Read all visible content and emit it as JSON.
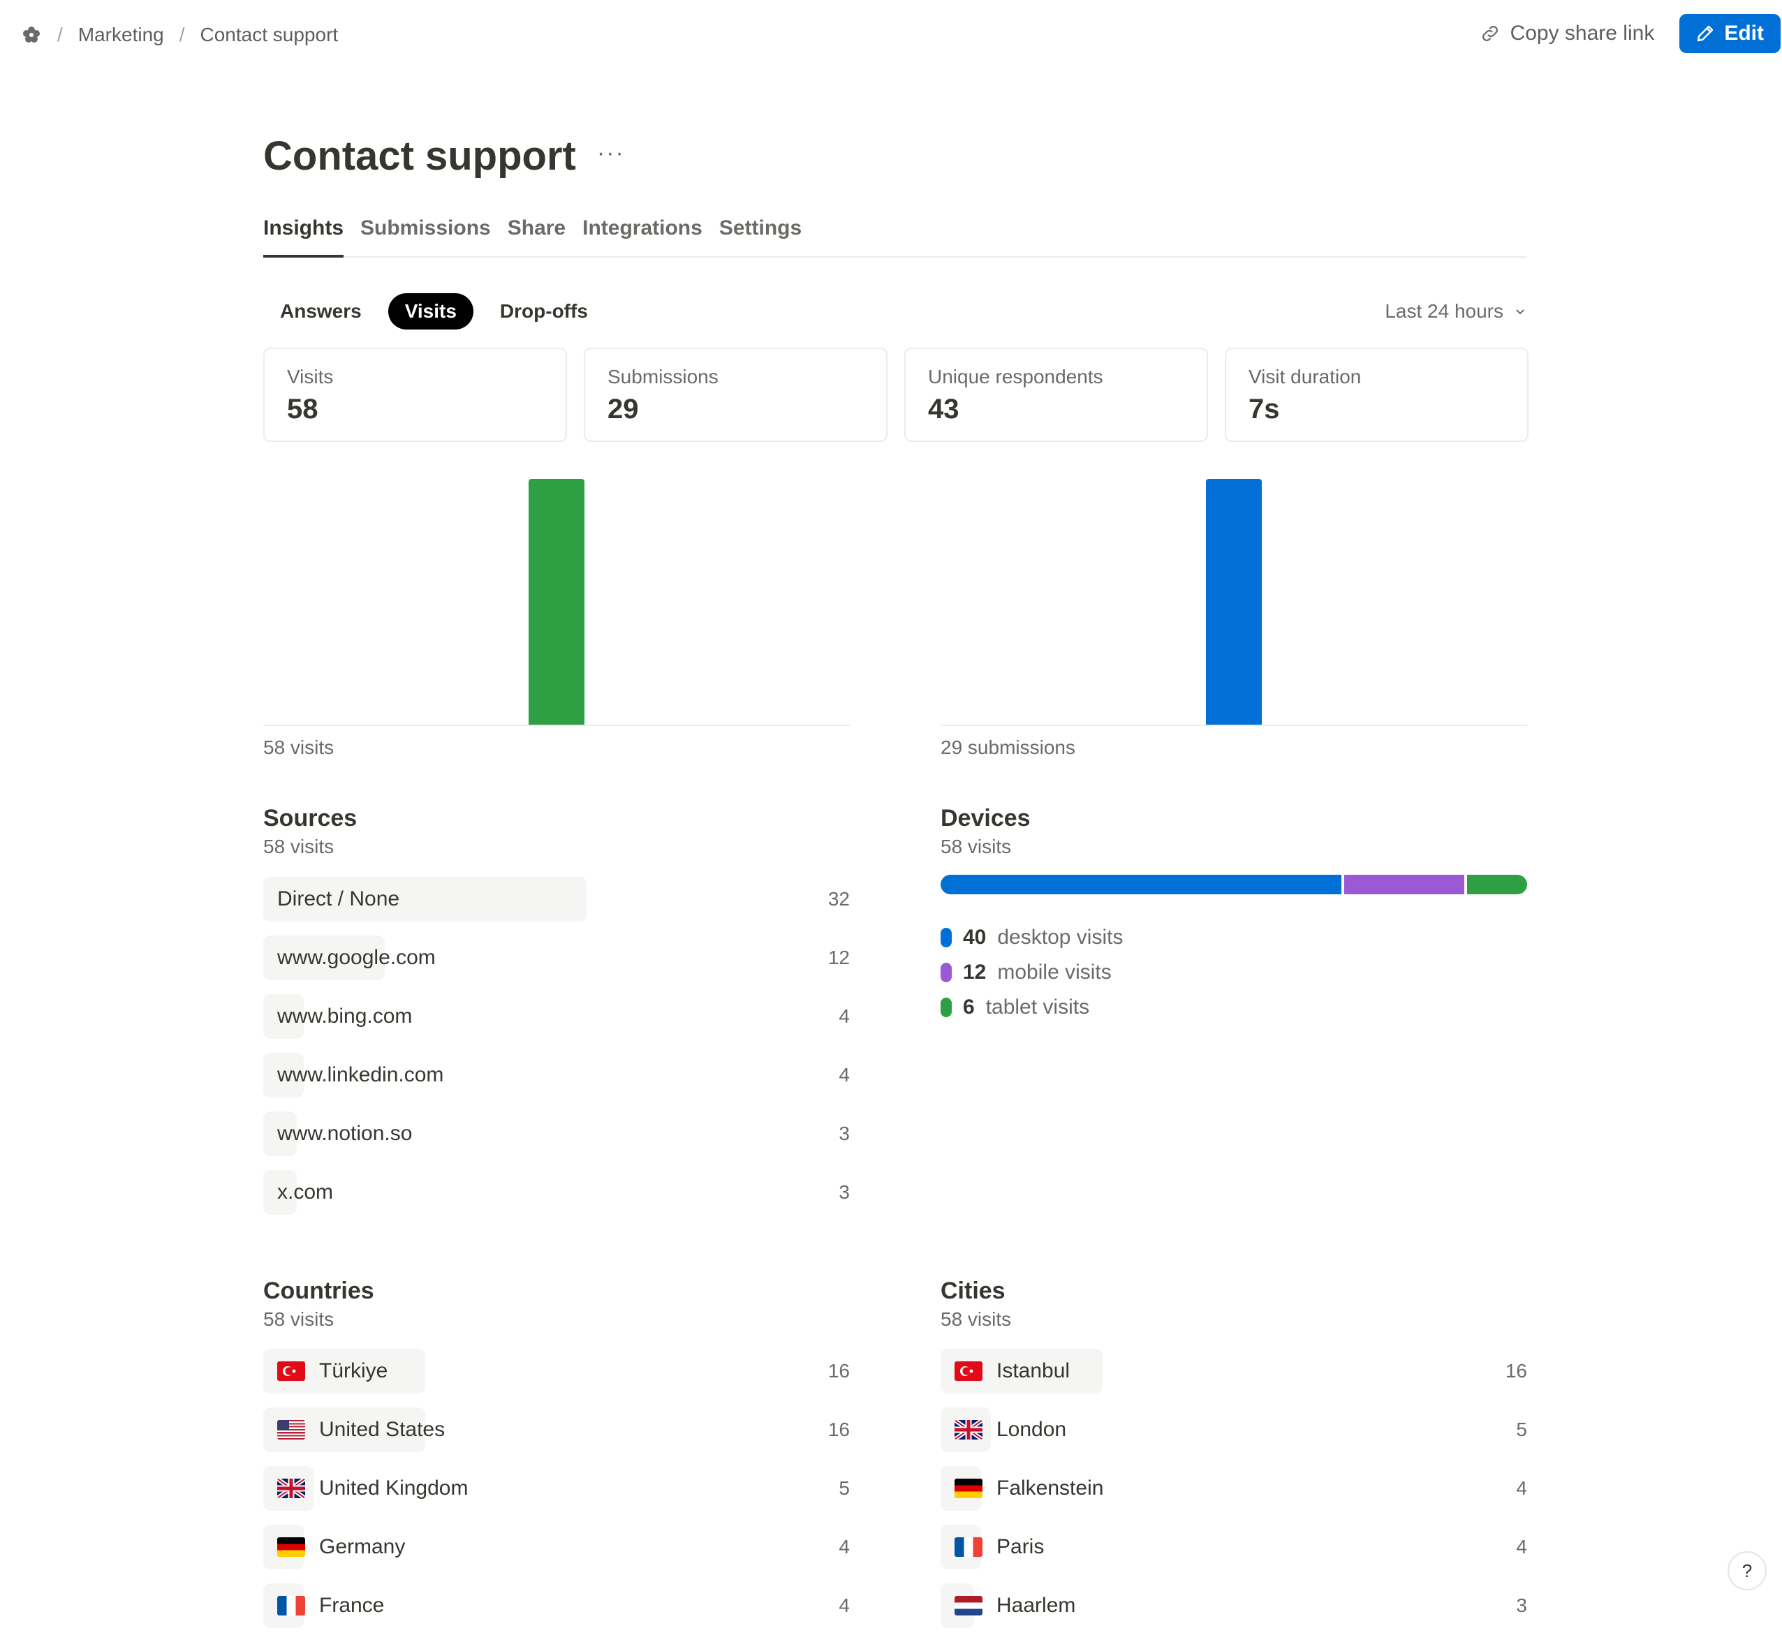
{
  "breadcrumb": {
    "parent": "Marketing",
    "current": "Contact support"
  },
  "header_actions": {
    "copy_link": "Copy share link",
    "edit": "Edit"
  },
  "colors": {
    "accent": "#0070d7",
    "green": "#2ea043",
    "purple": "#9b59d6"
  },
  "form": {
    "title": "Contact support",
    "more": "···"
  },
  "tabs": [
    {
      "label": "Insights",
      "active": true
    },
    {
      "label": "Submissions",
      "active": false
    },
    {
      "label": "Share",
      "active": false
    },
    {
      "label": "Integrations",
      "active": false
    },
    {
      "label": "Settings",
      "active": false
    }
  ],
  "subtabs": [
    {
      "label": "Answers",
      "active": false
    },
    {
      "label": "Visits",
      "active": true
    },
    {
      "label": "Drop-offs",
      "active": false
    }
  ],
  "range": {
    "label": "Last 24 hours"
  },
  "stats": [
    {
      "label": "Visits",
      "value": "58"
    },
    {
      "label": "Submissions",
      "value": "29"
    },
    {
      "label": "Unique respondents",
      "value": "43"
    },
    {
      "label": "Visit duration",
      "value": "7s"
    }
  ],
  "charts": {
    "visits_caption": "58 visits",
    "submissions_caption": "29 submissions"
  },
  "chart_data": [
    {
      "type": "bar",
      "series": [
        {
          "values": [
            58
          ]
        }
      ]
    },
    {
      "type": "bar",
      "series": [
        {
          "values": [
            29
          ]
        }
      ]
    }
  ],
  "sources": {
    "title": "Sources",
    "subtitle": "58 visits",
    "items": [
      {
        "label": "Direct / None",
        "count": "32",
        "value": 32
      },
      {
        "label": "www.google.com",
        "count": "12",
        "value": 12
      },
      {
        "label": "www.bing.com",
        "count": "4",
        "value": 4
      },
      {
        "label": "www.linkedin.com",
        "count": "4",
        "value": 4
      },
      {
        "label": "www.notion.so",
        "count": "3",
        "value": 3
      },
      {
        "label": "x.com",
        "count": "3",
        "value": 3
      }
    ]
  },
  "devices": {
    "title": "Devices",
    "subtitle": "58 visits",
    "items": [
      {
        "count": "40",
        "label": "desktop visits",
        "value": 40,
        "color": "#0070d7"
      },
      {
        "count": "12",
        "label": "mobile visits",
        "value": 12,
        "color": "#9b59d6"
      },
      {
        "count": "6",
        "label": "tablet visits",
        "value": 6,
        "color": "#2ea043"
      }
    ]
  },
  "countries": {
    "title": "Countries",
    "subtitle": "58 visits",
    "items": [
      {
        "label": "Türkiye",
        "count": "16",
        "value": 16,
        "flag": "tr-flag"
      },
      {
        "label": "United States",
        "count": "16",
        "value": 16,
        "flag": "us-flag"
      },
      {
        "label": "United Kingdom",
        "count": "5",
        "value": 5,
        "flag": "gb-flag"
      },
      {
        "label": "Germany",
        "count": "4",
        "value": 4,
        "flag": "de-flag"
      },
      {
        "label": "France",
        "count": "4",
        "value": 4,
        "flag": "fr-flag"
      }
    ]
  },
  "cities": {
    "title": "Cities",
    "subtitle": "58 visits",
    "items": [
      {
        "label": "Istanbul",
        "count": "16",
        "value": 16,
        "flag": "tr-flag"
      },
      {
        "label": "London",
        "count": "5",
        "value": 5,
        "flag": "gb-flag"
      },
      {
        "label": "Falkenstein",
        "count": "4",
        "value": 4,
        "flag": "de-flag"
      },
      {
        "label": "Paris",
        "count": "4",
        "value": 4,
        "flag": "fr-flag"
      },
      {
        "label": "Haarlem",
        "count": "3",
        "value": 3,
        "flag": "nl-flag"
      }
    ]
  },
  "help": {
    "label": "?"
  }
}
